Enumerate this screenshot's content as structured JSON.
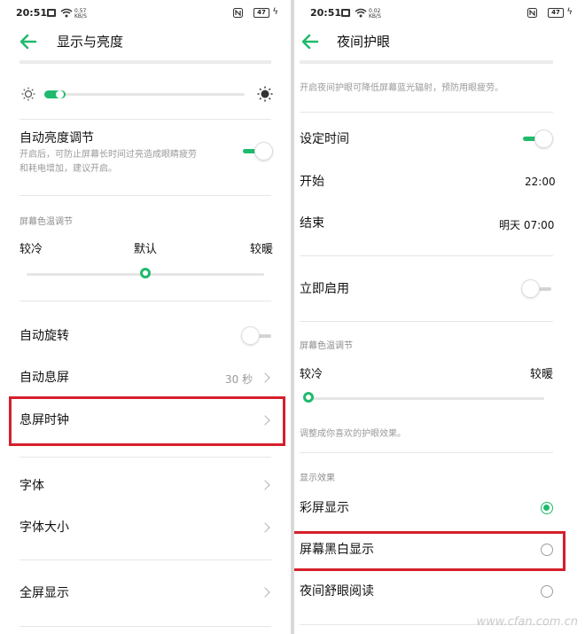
{
  "left": {
    "status": {
      "time": "20:51",
      "net_speed": "0.57",
      "net_unit": "KB/S",
      "battery": "47"
    },
    "header": {
      "title": "显示与亮度"
    },
    "brightness": {
      "level": 0.05
    },
    "auto_brightness": {
      "label": "自动亮度调节",
      "hint_line1": "开启后，可防止屏幕长时间过亮造成眼睛疲劳",
      "hint_line2": "和耗电增加，建议开启。",
      "on": true
    },
    "color_temp": {
      "section": "屏幕色温调节",
      "cool": "较冷",
      "default": "默认",
      "warm": "较暖",
      "level": 0.5
    },
    "auto_rotate": {
      "label": "自动旋转",
      "on": false
    },
    "auto_sleep": {
      "label": "自动息屏",
      "value": "30 秒"
    },
    "aod_clock": {
      "label": "息屏时钟"
    },
    "font": {
      "label": "字体"
    },
    "font_size": {
      "label": "字体大小"
    },
    "fullscreen": {
      "label": "全屏显示"
    }
  },
  "right": {
    "status": {
      "time": "20:51",
      "net_speed": "0.02",
      "net_unit": "KB/S",
      "battery": "47"
    },
    "header": {
      "title": "夜间护眼"
    },
    "intro": "开启夜间护眼可降低屏幕蓝光辐射，预防用眼疲劳。",
    "schedule": {
      "label": "设定时间",
      "on": true
    },
    "start": {
      "label": "开始",
      "value": "22:00"
    },
    "end": {
      "label": "结束",
      "value": "明天 07:00"
    },
    "enable_now": {
      "label": "立即启用",
      "on": false
    },
    "color_temp": {
      "section": "屏幕色温调节",
      "cool": "较冷",
      "warm": "较暖",
      "hint": "调整成你喜欢的护眼效果。",
      "level": 0.0
    },
    "effect": {
      "section": "显示效果",
      "options": [
        {
          "label": "彩屏显示",
          "selected": true
        },
        {
          "label": "屏幕黑白显示",
          "selected": false
        },
        {
          "label": "夜间舒眼阅读",
          "selected": false
        }
      ]
    },
    "watermark": "www.cfan.com.cn"
  },
  "colors": {
    "accent": "#1fba6c",
    "highlight": "#d51f2b"
  }
}
